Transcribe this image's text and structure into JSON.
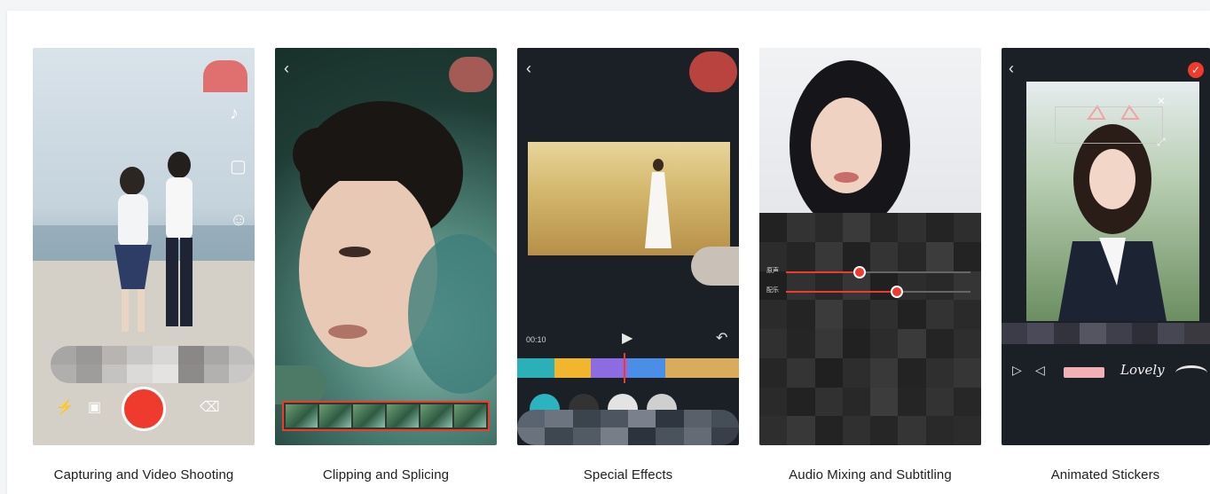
{
  "features": [
    {
      "id": "capture",
      "caption": "Capturing and Video Shooting"
    },
    {
      "id": "clip",
      "caption": "Clipping and Splicing"
    },
    {
      "id": "effects",
      "caption": "Special Effects",
      "time_label": "00:10"
    },
    {
      "id": "audio",
      "caption": "Audio Mixing and Subtitling",
      "slider_labels": [
        "原声",
        "配乐"
      ]
    },
    {
      "id": "stickers",
      "caption": "Animated Stickers",
      "sticker_text": "Lovely"
    }
  ],
  "colors": {
    "accent": "#ef3b2d",
    "dark_ui": "#1b1f26",
    "caption_text": "#1f1f1f"
  }
}
